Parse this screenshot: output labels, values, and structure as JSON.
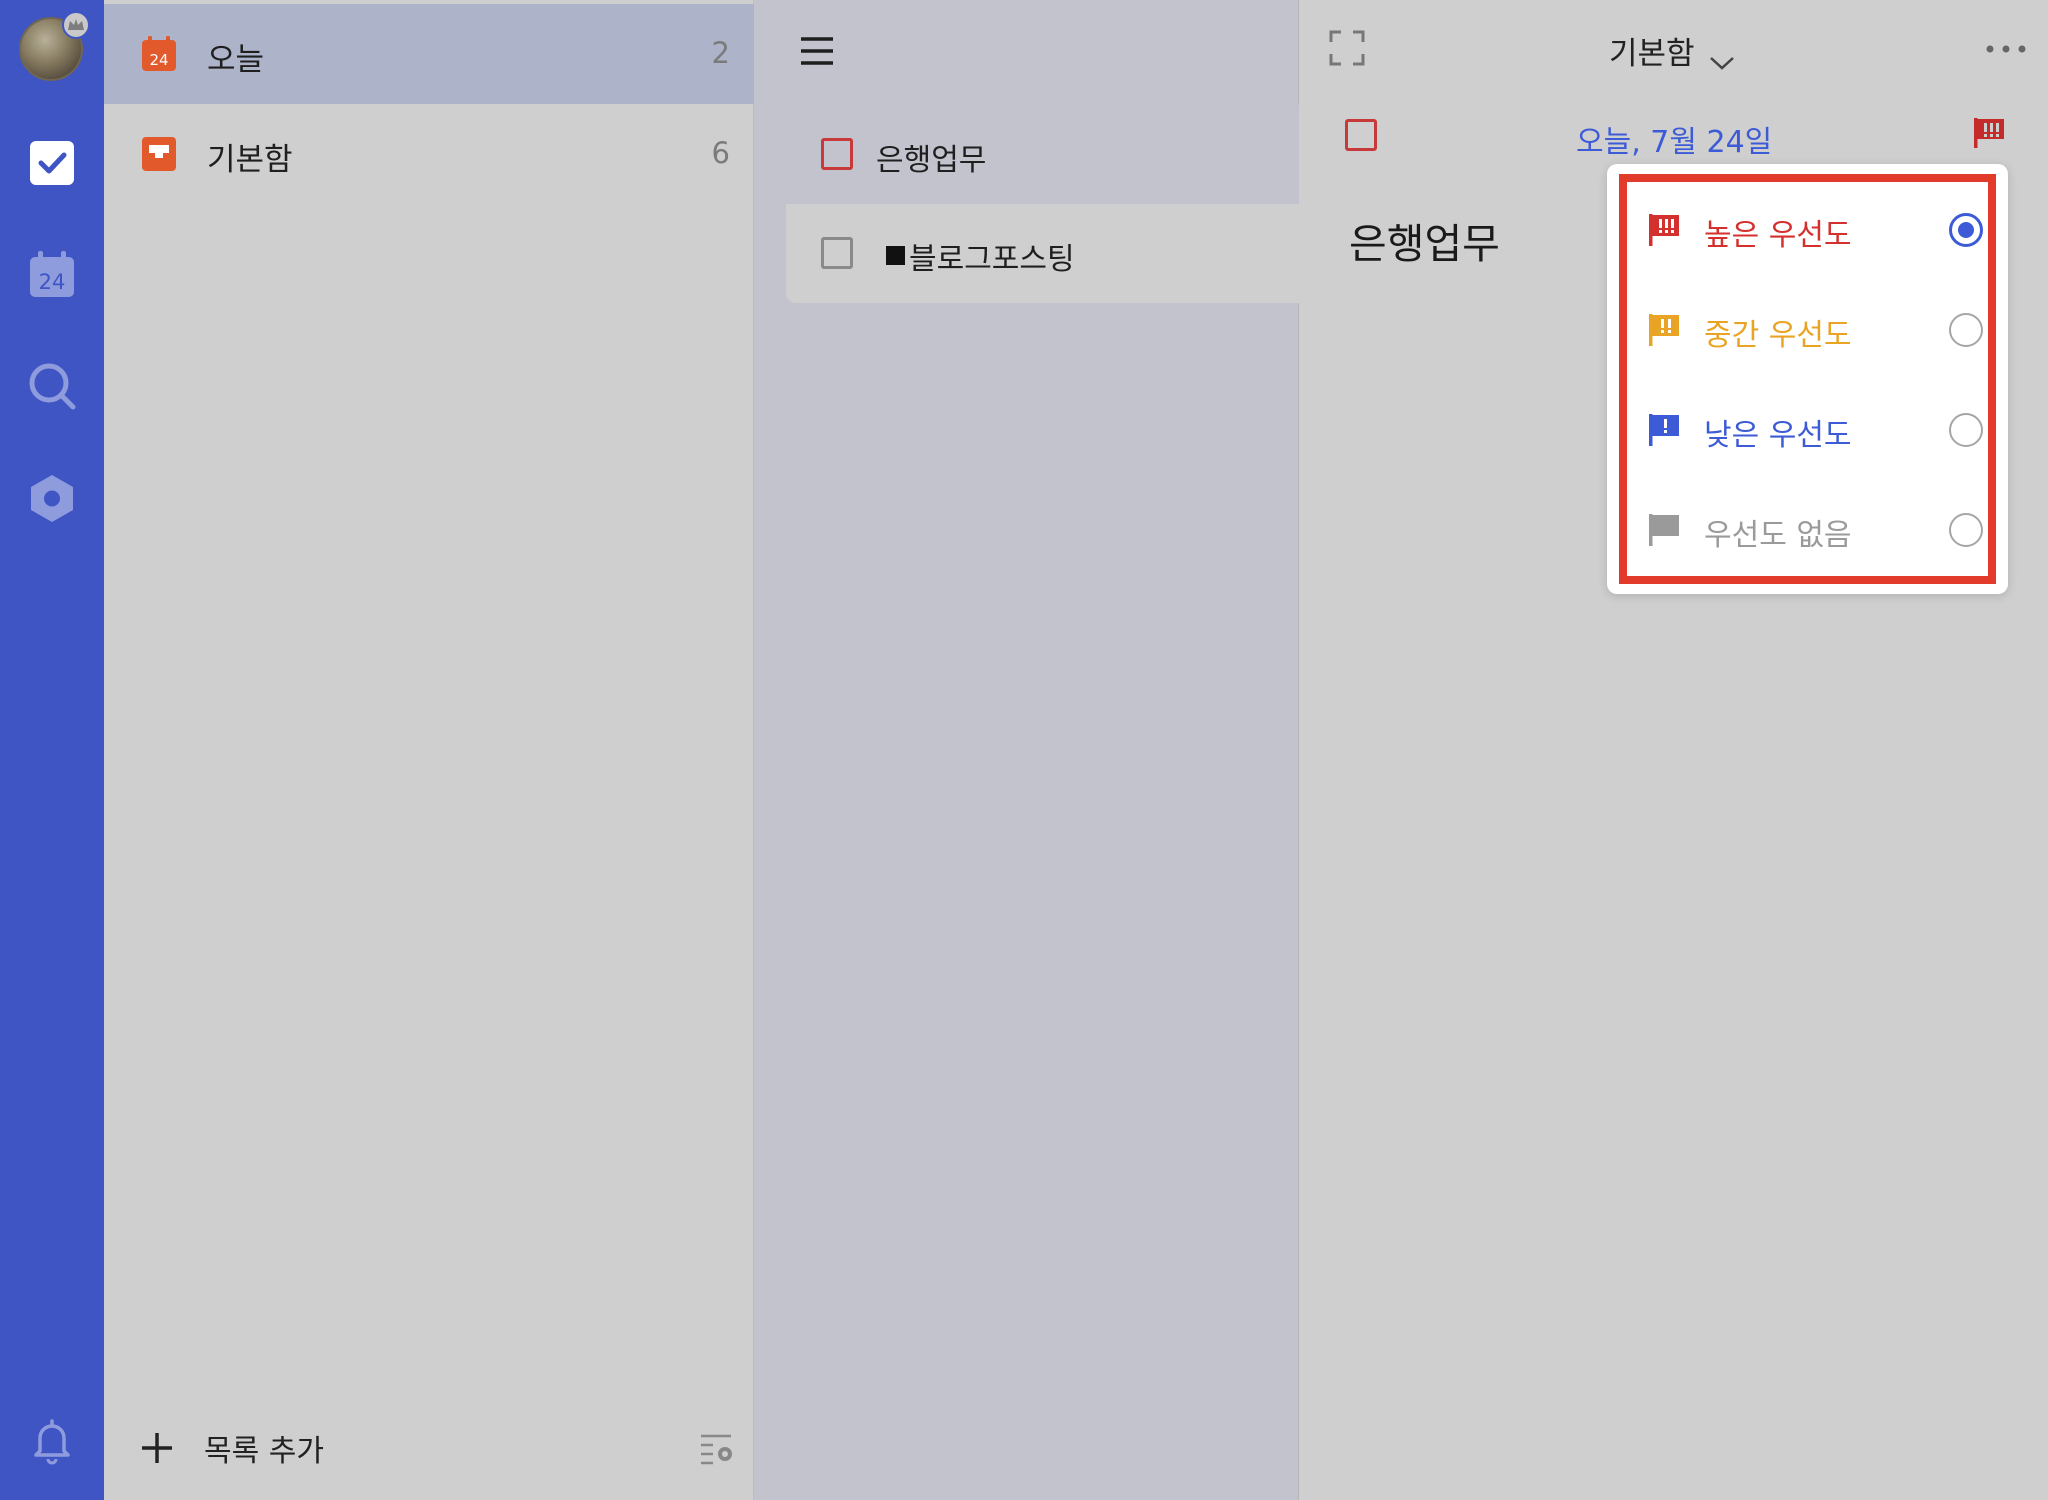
{
  "sidebar": {
    "items": [
      {
        "label": "오늘",
        "count": "2",
        "icon": "calendar-24-icon",
        "calendar_number": "24"
      },
      {
        "label": "기본함",
        "count": "6",
        "icon": "inbox-icon"
      }
    ],
    "add_list_label": "목록 추가"
  },
  "rail": {
    "calendar_number": "24"
  },
  "task_list": {
    "tasks": [
      {
        "label": "은행업무"
      },
      {
        "label": "블로그포스팅"
      }
    ]
  },
  "detail": {
    "list_name": "기본함",
    "date": "오늘, 7월 24일",
    "task_title": "은행업무"
  },
  "priority_menu": {
    "options": [
      {
        "label": "높은 우선도",
        "color": "#d4302e",
        "selected": true
      },
      {
        "label": "중간 우선도",
        "color": "#eaa425",
        "selected": false
      },
      {
        "label": "낮은 우선도",
        "color": "#3d5bd6",
        "selected": false
      },
      {
        "label": "우선도 없음",
        "color": "#9a9a9a",
        "selected": false
      }
    ]
  },
  "colors": {
    "rail": "#3f55c4",
    "accent": "#3d5bd6",
    "high": "#d4302e",
    "highlight_frame": "#e33b2b"
  }
}
